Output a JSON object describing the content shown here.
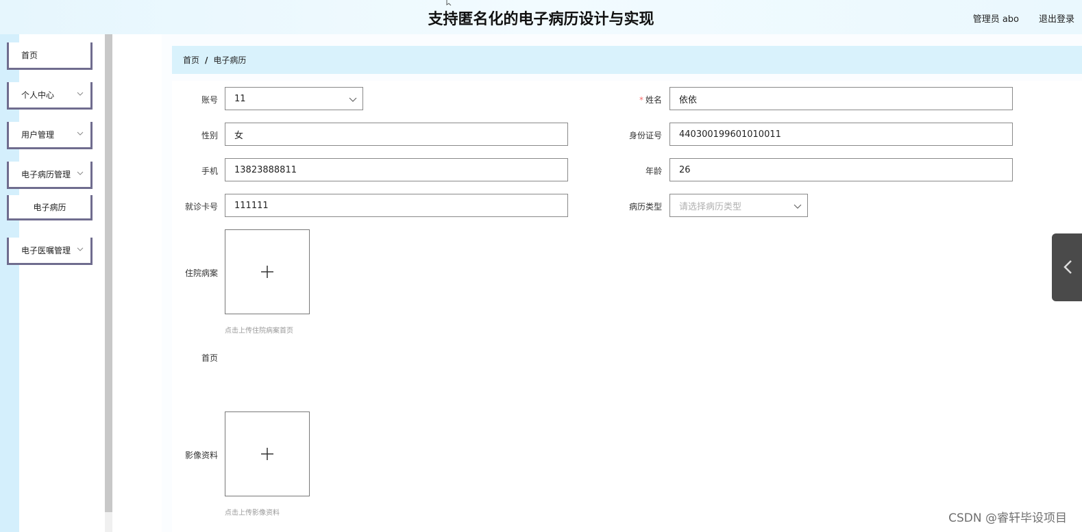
{
  "header": {
    "title": "支持匿名化的电子病历设计与实现",
    "user": "管理员 abo",
    "logout": "退出登录"
  },
  "sidebar": {
    "items": [
      {
        "label": "首页",
        "has_chevron": false
      },
      {
        "label": "个人中心",
        "has_chevron": true
      },
      {
        "label": "用户管理",
        "has_chevron": true
      },
      {
        "label": "电子病历管理",
        "has_chevron": true
      },
      {
        "label": "电子病历",
        "sub": true
      },
      {
        "label": "电子医嘱管理",
        "has_chevron": true
      }
    ]
  },
  "breadcrumb": {
    "home": "首页",
    "separator": "/",
    "current": "电子病历"
  },
  "form": {
    "account": {
      "label": "账号",
      "value": "11"
    },
    "name": {
      "label": "姓名",
      "required_mark": "*",
      "value": "依依"
    },
    "gender": {
      "label": "性别",
      "value": "女"
    },
    "id_number": {
      "label": "身份证号",
      "value": "440300199601010011"
    },
    "phone": {
      "label": "手机",
      "value": "13823888811"
    },
    "age": {
      "label": "年龄",
      "value": "26"
    },
    "card_number": {
      "label": "就诊卡号",
      "value": "111111"
    },
    "record_type": {
      "label": "病历类型",
      "placeholder": "请选择病历类型"
    },
    "inpatient_record": {
      "label": "住院病案",
      "tip": "点击上传住院病案首页"
    },
    "home_page": {
      "label": "首页"
    },
    "imaging": {
      "label": "影像资料",
      "tip": "点击上传影像资料"
    }
  },
  "watermark": "CSDN @睿轩毕设项目",
  "colors": {
    "header_bg": "#e6f6fd",
    "breadcrumb_bg": "#d9f2fc",
    "menu_border": "#6f6c8e",
    "required": "#f56c6c",
    "drawer_tab": "#4a4a4a"
  },
  "icons": [
    "chevron-down-icon",
    "plus-icon",
    "chevron-left-icon"
  ]
}
